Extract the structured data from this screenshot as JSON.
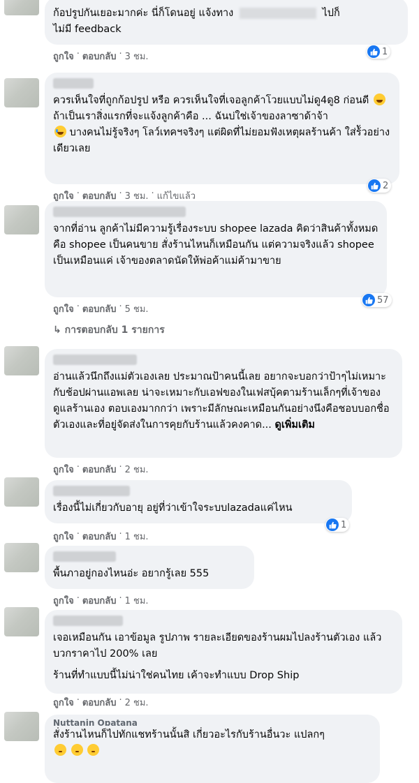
{
  "comments": [
    {
      "lines": [
        "ก้อปรูปกันเยอะมากค่ะ นี่ก็โดนอยู่ แจ้งทาง",
        "ไปก็",
        "ไม่มี feedback"
      ],
      "like_label": "ถูกใจ",
      "reply_label": "ตอบกลับ",
      "time": "3 ชม.",
      "reactions": "1"
    },
    {
      "text": "ควรเห็นใจที่ถูกก้อปรูป หรือ ควรเห็นใจที่เจอลูกค้าโวยแบบไม่ดู4ดู8 ก่อนดี",
      "text2": "ถ้าเป็นเราสิ่งแรกที่จะแจ้งลูกค้าคือ ... ฉันบ่ใช่เจ้าของลาซาด้าจ้า",
      "text3": "บางคนไม่รู้จริงๆ โลว์เทคฯจริงๆ แต่ผิดที่ไม่ยอมฟังเหตุผลร้านค้า ใส่ร้ัวอย่างเดียวเลย",
      "like_label": "ถูกใจ",
      "reply_label": "ตอบกลับ",
      "time": "3 ชม.",
      "edited": "แก้ไขแล้ว",
      "reactions": "2"
    },
    {
      "text": "จากที่อ่าน ลูกค้าไม่มีความรู้เรื่องระบบ shopee lazada คิดว่าสินค้าทั้งหมดคือ shopee เป็นคนขาย สั่งร้านไหนก็เหมือนกัน แต่ความจริงแล้ว shopee เป็นเหมือนแค่ เจ้าของตลาดนัดให้พ่อค้าแม่ค้ามาขาย",
      "like_label": "ถูกใจ",
      "reply_label": "ตอบกลับ",
      "time": "5 ชม.",
      "reactions": "57",
      "replies_link": "การตอบกลับ 1 รายการ"
    },
    {
      "text": "อ่านแล้วนึกถึงแม่ตัวเองเลย ประมาณป้าคนนี้เลย อยากจะบอกว่าป้าๆไม่เหมาะกับช้อปผ่านแอพเลย น่าจะเหมาะกับเอฟของในเฟสบุ้คตามร้านเล็กๆที่เจ้าของดูแลร้านเอง ตอบเองมากกว่า เพราะมีลักษณะเหมือนกันอย่างนึงคือชอบบอกชื่อตัวเองและที่อยู่จัดส่งในการคุยกับร้านแล้วคงคาด...",
      "see_more": "ดูเพิ่มเติม",
      "like_label": "ถูกใจ",
      "reply_label": "ตอบกลับ",
      "time": "2 ชม."
    },
    {
      "text": "เรื่องนี้ไม่เกี่ยวกับอายุ อยู่ที่ว่าเข้าใจระบบlazadaแค่ไหน",
      "like_label": "ถูกใจ",
      "reply_label": "ตอบกลับ",
      "time": "1 ชม.",
      "reactions": "1"
    },
    {
      "text": "พื้นภาอยู่กองไหนอ่ะ อยากรู้เลย 555",
      "like_label": "ถูกใจ",
      "reply_label": "ตอบกลับ",
      "time": "1 ชม."
    },
    {
      "text": "เจอเหมือนกัน เอาข้อมูล รูปภาพ รายละเอียดของร้านผมไปลงร้านตัวเอง แล้วบวกราคาไป 200% เลย",
      "text2": "ร้านที่ทำแบบนี้ไม่น่าใช่คนไทย เค้าจะทำแบบ Drop Ship",
      "like_label": "ถูกใจ",
      "reply_label": "ตอบกลับ",
      "time": "2 ชม."
    },
    {
      "name": "Nuttanin Opatana",
      "text": "สั่งร้านไหนก็ไปทักแชทร้านนั้นสิ เกี่ยวอะไรกับร้านอื่นวะ แปลกๆ"
    }
  ],
  "separator": "·",
  "colors": {
    "accent": "#1877f2",
    "bubble": "#f0f2f5",
    "meta": "#65676b"
  },
  "icons": {
    "reaction": "like-thumb-icon",
    "reply_arrow": "reply-arrow-icon",
    "emoji": "emoji-icon"
  }
}
